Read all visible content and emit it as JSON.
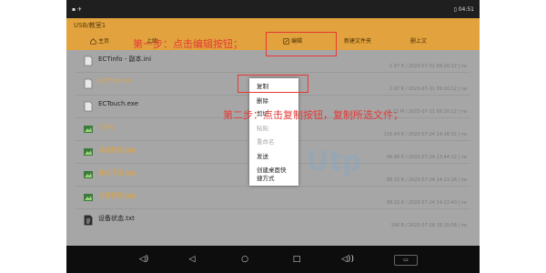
{
  "status_bar": {
    "left": "▪ ✈",
    "time": "▯ 04:51"
  },
  "path": "USB/教室1",
  "toolbar": {
    "home": "主页",
    "up": "上级",
    "edit": "编辑",
    "new_folder": "新建文件夹",
    "upload": "删上文"
  },
  "files": [
    {
      "name": "ECTinfo - 副本.ini",
      "meta": "2.97 K / 2023-07-31 09:20:12 | rw",
      "icon": "doc-icon",
      "media": false
    },
    {
      "name": "ECTinfo.ini",
      "meta": "2.97 K / 2023-07-31 09:20:12 | rw",
      "icon": "doc-icon",
      "media": true
    },
    {
      "name": "ECTouch.exe",
      "meta": "1.23 M / 2023-07-31 09:20:12 | rw",
      "icon": "doc-icon",
      "media": false
    },
    {
      "name": "3.jpg",
      "meta": "116.64 K / 2023-07-24 14:16:32 | rw",
      "icon": "image-icon",
      "media": true
    },
    {
      "name": "桌面控制.jpg",
      "meta": "96.98 K / 2023-07-24 13:44:12 | rw",
      "icon": "image-icon",
      "media": true
    },
    {
      "name": "确认下载.jpg",
      "meta": "88.32 K / 2023-07-24 14:21:28 | rw",
      "icon": "image-icon",
      "media": true
    },
    {
      "name": "设备控制.jpg",
      "meta": "88.32 K / 2023-07-24 14:22:40 | rw",
      "icon": "image-icon",
      "media": true
    },
    {
      "name": "设备状态.txt",
      "meta": "166 B / 2023-07-26 16:15:58 | rw",
      "icon": "text-icon",
      "media": false
    }
  ],
  "context_menu": {
    "copy": "复制",
    "delete": "删除",
    "cut": "剪切",
    "paste": "粘贴",
    "rename": "重命名",
    "send": "发送",
    "shortcut_line1": "创建桌面快",
    "shortcut_line2": "捷方式"
  },
  "annotations": {
    "step1": "第一步：点击编辑按钮；",
    "step2": "第二步：点击复制按钮，复制所选文件；"
  },
  "watermark": "Utp",
  "colors": {
    "header": "#e2a33e",
    "annotation": "#e53935",
    "list_bg": "#a6a6a6"
  }
}
